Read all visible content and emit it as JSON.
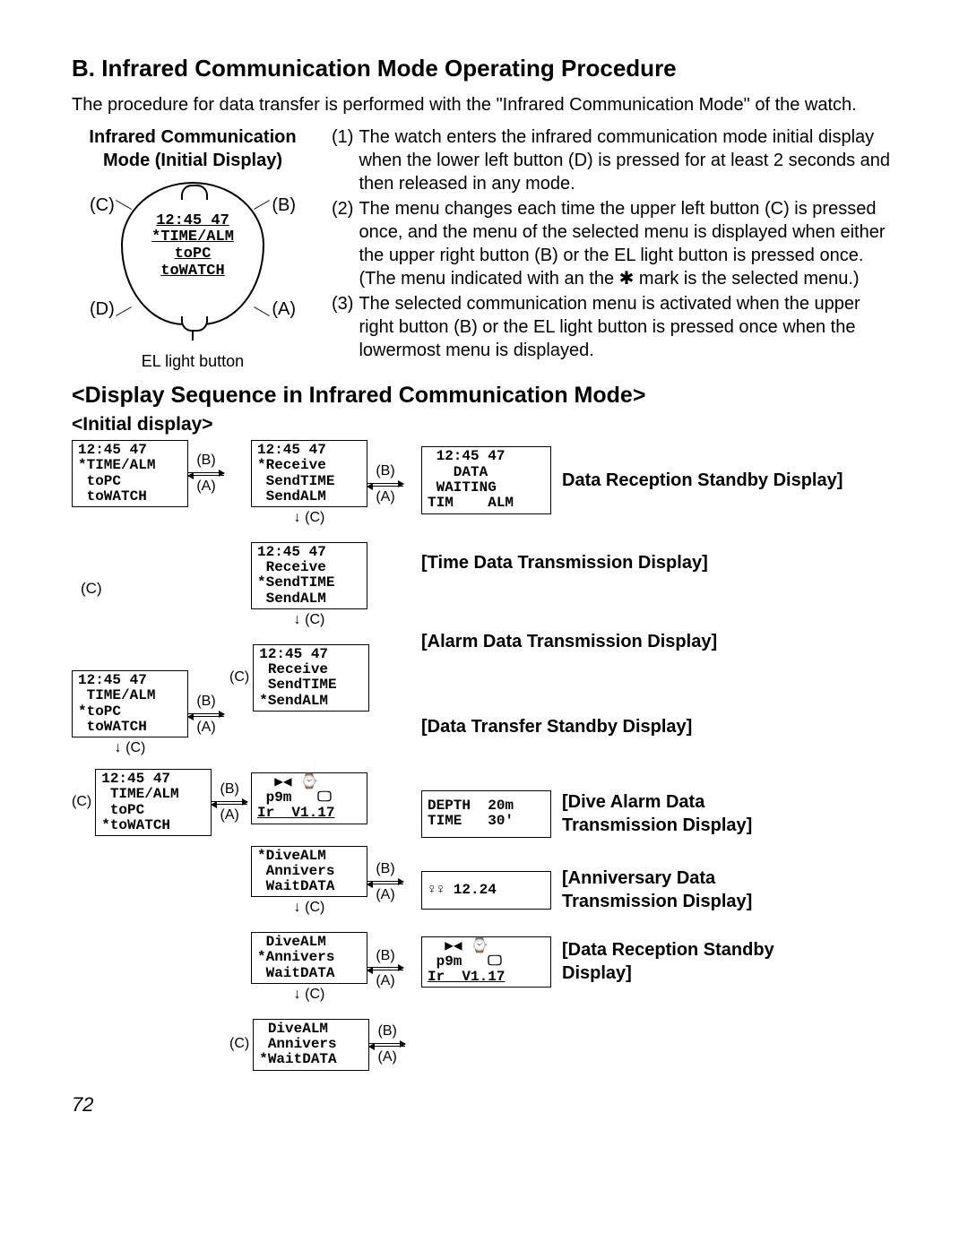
{
  "heading": "B. Infrared Communication Mode Operating Procedure",
  "intro": "The procedure for data transfer is performed with the \"Infrared Communication Mode\" of the watch.",
  "watch": {
    "title": "Infrared Communication Mode (Initial Display)",
    "screen_l1": "12:45 47",
    "screen_l2": "*TIME/ALM",
    "screen_l3": "toPC",
    "screen_l4": "toWATCH",
    "lbl_c": "(C)",
    "lbl_b": "(B)",
    "lbl_d": "(D)",
    "lbl_a": "(A)",
    "el_label": "EL light button"
  },
  "steps": [
    {
      "num": "(1)",
      "text": "The watch enters the infrared communication mode initial display when the lower left button (D) is pressed for at least 2 seconds and then released in any mode."
    },
    {
      "num": "(2)",
      "text": "The menu changes each time the upper left button (C) is pressed once, and the menu of the selected menu is displayed when either the upper right button (B) or the EL light button is pressed once.  (The menu indicated with an the ✱ mark is the selected menu.)"
    },
    {
      "num": "(3)",
      "text": "The selected communication menu is activated when the upper right button (B) or the EL light button is pressed once when the lowermost menu is displayed."
    }
  ],
  "seq_heading": "<Display Sequence in Infrared Communication Mode>",
  "seq_sub": "<Initial display>",
  "nav": {
    "b": "(B)",
    "a": "(A)",
    "c": "(C)"
  },
  "left_boxes": {
    "b1": "12:45 47\n*TIME/ALM\n toPC\n toWATCH",
    "b2": "12:45 47\n TIME/ALM\n*toPC\n toWATCH",
    "b3": "12:45 47\n TIME/ALM\n toPC\n*toWATCH"
  },
  "mid_boxes": {
    "m1": "12:45 47\n*Receive\n SendTIME\n SendALM",
    "m2": "12:45 47\n Receive\n*SendTIME\n SendALM",
    "m3": "12:45 47\n Receive\n SendTIME\n*SendALM",
    "m4_l1": "  ▶◀ ⌚",
    "m4_l2": " p9m   🖵",
    "m4_l3": "Ir  V1.17",
    "m5": "*DiveALM\n Annivers\n WaitDATA",
    "m6": " DiveALM\n*Annivers\n WaitDATA",
    "m7": " DiveALM\n Annivers\n*WaitDATA"
  },
  "result_boxes": {
    "r1": " 12:45 47\n   DATA\n WAITING\nTIM    ALM",
    "r5": "DEPTH  20m\nTIME   30'",
    "r6": "♀♀ 12.24",
    "r7_l1": "  ▶◀ ⌚",
    "r7_l2": " p9m   🖵",
    "r7_l3": "Ir  V1.17"
  },
  "labels": {
    "l1": "Data Reception Standby Display]",
    "l2": "[Time Data Transmission Display]",
    "l3": "[Alarm Data Transmission Display]",
    "l4": "[Data Transfer Standby Display]",
    "l5": "[Dive Alarm Data Transmission Display]",
    "l6": "[Anniversary Data Transmission Display]",
    "l7": "[Data Reception Standby Display]"
  },
  "page": "72"
}
